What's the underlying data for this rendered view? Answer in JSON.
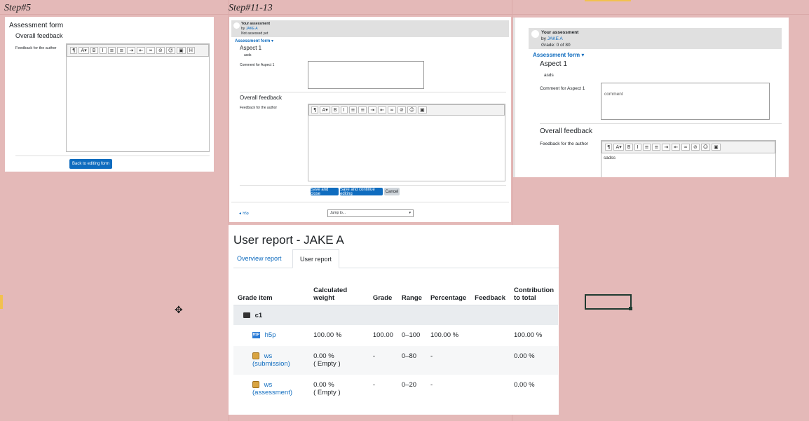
{
  "labels": {
    "step5": "Step#5",
    "step11_13": "Step#11-13"
  },
  "panel_a": {
    "title": "Assessment form",
    "subtitle": "Overall feedback",
    "field_label": "Feedback for the author",
    "back_button": "Back to editing form"
  },
  "panel_b": {
    "your_assessment": "Your assessment",
    "by": "by",
    "author": "JAKE A",
    "status": "Not assessed yet",
    "assessment_form": "Assessment form",
    "aspect_title": "Aspect 1",
    "aspect_desc": "asds",
    "comment_label": "Comment for Aspect 1",
    "overall_feedback": "Overall feedback",
    "feedback_label": "Feedback for the author",
    "save_close": "Save and close",
    "save_continue": "Save and continue editing",
    "cancel": "Cancel",
    "back_link": "◄ h5p",
    "jump_to": "Jump to..."
  },
  "panel_c": {
    "your_assessment": "Your assessment",
    "by": "by",
    "author": "JAKE A",
    "grade": "Grade: 0 of 80",
    "assessment_form": "Assessment form",
    "aspect_title": "Aspect 1",
    "aspect_desc": "asds",
    "comment_label": "Comment for Aspect 1",
    "comment_value": "comment",
    "overall_feedback": "Overall feedback",
    "feedback_label": "Feedback for the author",
    "feedback_value": "sadss"
  },
  "report": {
    "title": "User report - JAKE A",
    "tabs": [
      "Overview report",
      "User report"
    ],
    "columns": [
      "Grade item",
      "Calculated weight",
      "Grade",
      "Range",
      "Percentage",
      "Feedback",
      "Contribution to total"
    ],
    "category": "c1",
    "rows": [
      {
        "name": "h5p",
        "weight": "100.00 %",
        "weight2": "",
        "grade": "100.00",
        "range": "0–100",
        "percentage": "100.00 %",
        "feedback": "",
        "contribution": "100.00 %"
      },
      {
        "name": "ws (submission)",
        "weight": "0.00 %",
        "weight2": "( Empty )",
        "grade": "-",
        "range": "0–80",
        "percentage": "-",
        "feedback": "",
        "contribution": "0.00 %"
      },
      {
        "name": "ws (assessment)",
        "weight": "0.00 %",
        "weight2": "( Empty )",
        "grade": "-",
        "range": "0–20",
        "percentage": "-",
        "feedback": "",
        "contribution": "0.00 %"
      }
    ]
  },
  "icons": {
    "toolbar": [
      "paragraph-icon",
      "font-size-icon",
      "bold-icon",
      "italic-icon",
      "unordered-list-icon",
      "ordered-list-icon",
      "indent-icon",
      "outdent-icon",
      "link-icon",
      "unlink-icon",
      "emoji-icon",
      "image-icon",
      "h5p-icon"
    ]
  }
}
